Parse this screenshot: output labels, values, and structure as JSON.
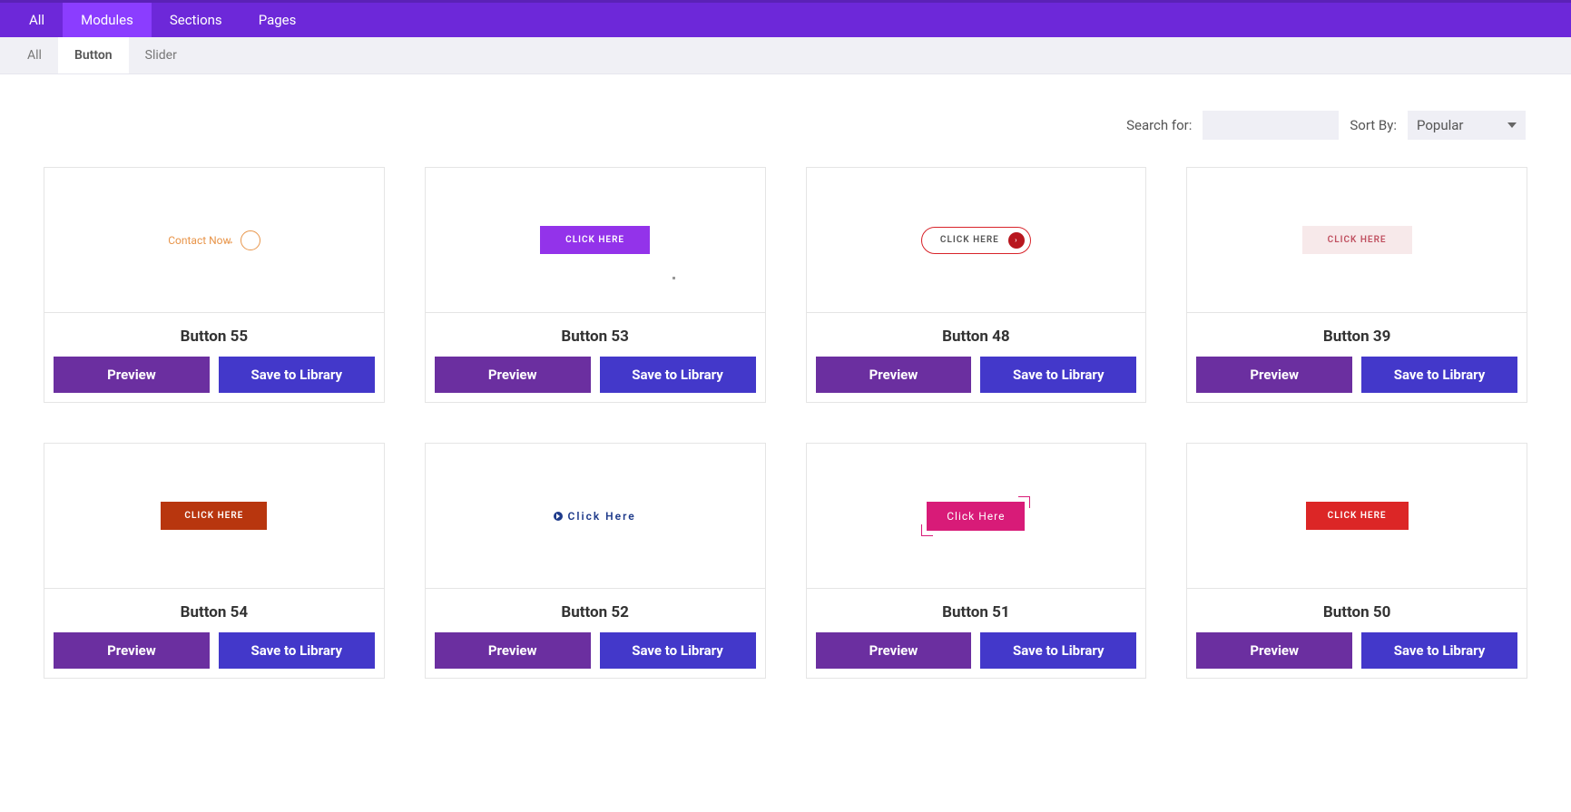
{
  "topbar": {
    "tabs": [
      {
        "label": "All"
      },
      {
        "label": "Modules",
        "active": true
      },
      {
        "label": "Sections"
      },
      {
        "label": "Pages"
      }
    ]
  },
  "subbar": {
    "tabs": [
      {
        "label": "All"
      },
      {
        "label": "Button",
        "active": true
      },
      {
        "label": "Slider"
      }
    ]
  },
  "controls": {
    "search_label": "Search for:",
    "search_value": "",
    "sort_label": "Sort By:",
    "sort_value": "Popular"
  },
  "actions": {
    "preview_label": "Preview",
    "save_label": "Save to Library"
  },
  "thumb_text": {
    "contact_now": "Contact Now",
    "arrow": "→",
    "click_here_upper": "CLICK HERE",
    "click_here_title": "Click Here",
    "chevron": "›"
  },
  "items": [
    {
      "title": "Button 55",
      "variant": "t55"
    },
    {
      "title": "Button 53",
      "variant": "t53"
    },
    {
      "title": "Button 48",
      "variant": "t48"
    },
    {
      "title": "Button 39",
      "variant": "t39"
    },
    {
      "title": "Button 54",
      "variant": "t54"
    },
    {
      "title": "Button 52",
      "variant": "t52"
    },
    {
      "title": "Button 51",
      "variant": "t51"
    },
    {
      "title": "Button 50",
      "variant": "t50"
    }
  ]
}
